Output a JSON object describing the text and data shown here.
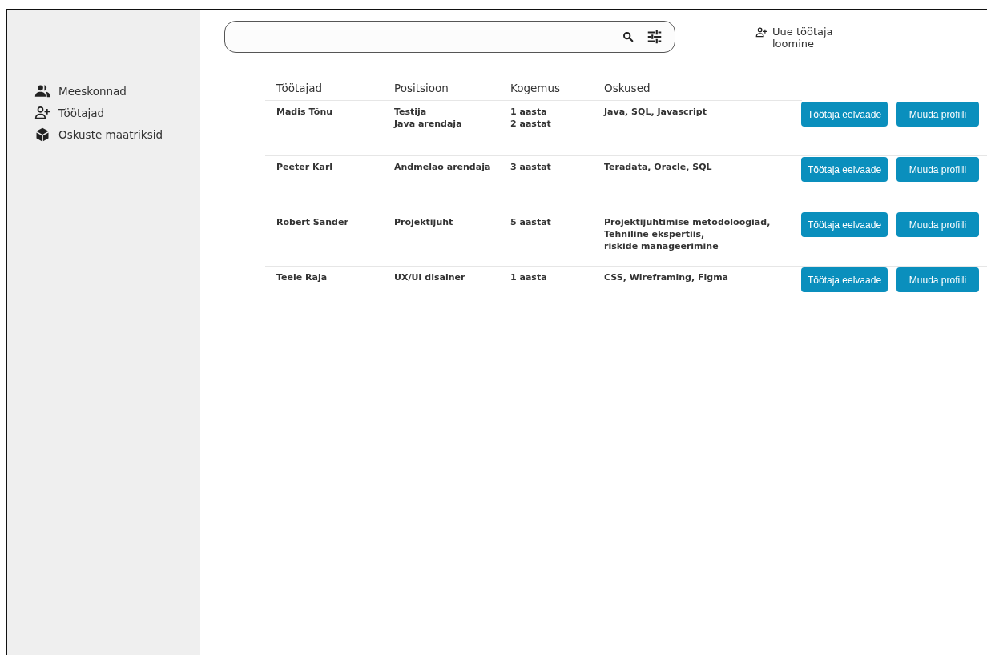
{
  "sidebar": {
    "items": [
      {
        "label": "Meeskonnad",
        "kind": "team"
      },
      {
        "label": "Töötajad",
        "kind": "person-add"
      },
      {
        "label": "Oskuste maatriksid",
        "kind": "cube"
      }
    ]
  },
  "new_employee_button": {
    "label": "Uue töötaja\nloomine"
  },
  "table": {
    "columns": [
      "Töötajad",
      "Positsioon",
      "Kogemus",
      "Oskused"
    ],
    "rows": [
      {
        "name": "Madis Tõnu",
        "position": "Testija\nJava arendaja",
        "experience": "1 aasta\n2 aastat",
        "skills": "Java, SQL, Javascript",
        "buttons": [
          "Töötaja eelvaade",
          "Muuda profiili"
        ]
      },
      {
        "name": "Peeter Karl",
        "position": "Andmelao arendaja",
        "experience": "3 aastat",
        "skills": "Teradata, Oracle, SQL",
        "buttons": [
          "Töötaja eelvaade",
          "Muuda profiili"
        ]
      },
      {
        "name": "Robert Sander",
        "position": "Projektijuht",
        "experience": "5 aastat",
        "skills": "Projektijuhtimise metodoloogiad,\nTehniline ekspertiis,\nriskide manageerimine",
        "buttons": [
          "Töötaja eelvaade",
          "Muuda profiili"
        ]
      },
      {
        "name": "Teele Raja",
        "position": "UX/UI disainer",
        "experience": "1 aasta",
        "skills": "CSS, Wireframing, Figma",
        "buttons": [
          "Töötaja eelvaade",
          "Muuda profiili"
        ]
      }
    ]
  }
}
